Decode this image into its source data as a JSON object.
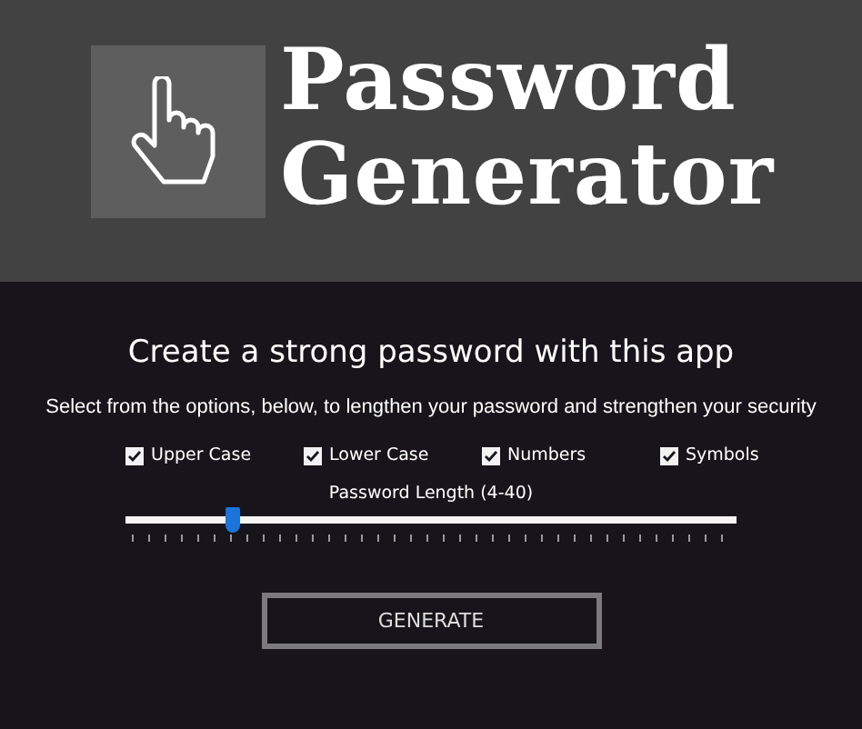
{
  "header": {
    "title_lines": [
      "Password",
      "Generator"
    ]
  },
  "heading": "Create a strong password with this app",
  "subtitle": "Select from the options, below, to lengthen your password and strengthen your security",
  "options": [
    {
      "label": "Upper Case",
      "checked": true
    },
    {
      "label": "Lower Case",
      "checked": true
    },
    {
      "label": "Numbers",
      "checked": true
    },
    {
      "label": "Symbols",
      "checked": true
    }
  ],
  "length": {
    "label": "Password Length (4-40)",
    "level": 0.175
  },
  "button": "GENERATE"
}
